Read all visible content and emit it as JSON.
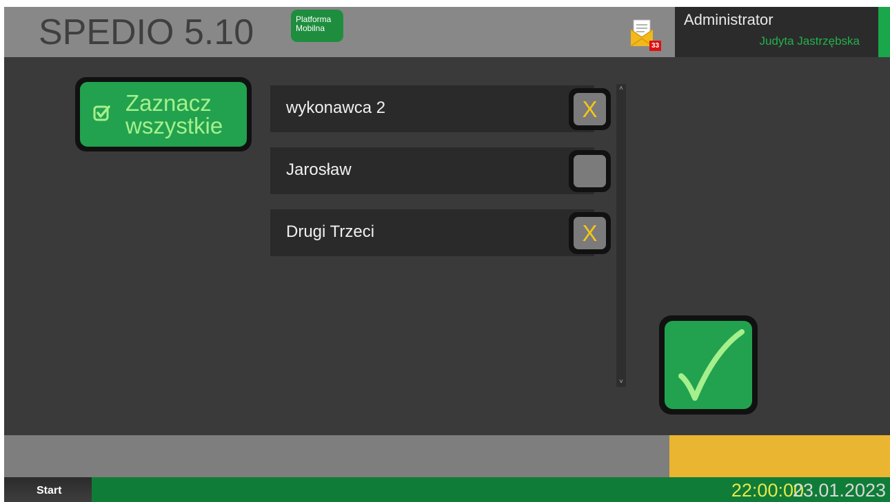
{
  "header": {
    "app_title": "SPEDIO 5.10",
    "platform_badge": [
      "Platforma",
      "Mobilna"
    ],
    "mail_icon": "envelope-document-icon",
    "mail_count": "33",
    "user_role": "Administrator",
    "user_name": "Judyta Jastrzębska"
  },
  "select_all": {
    "icon": "checkbox-checked-icon",
    "label": "Zaznacz wszystkie"
  },
  "list": {
    "items": [
      {
        "label": "wykonawca 2",
        "checked": true,
        "mark": "X"
      },
      {
        "label": "Jarosław",
        "checked": false,
        "mark": ""
      },
      {
        "label": "Drugi Trzeci",
        "checked": true,
        "mark": "X"
      }
    ]
  },
  "confirm": {
    "icon": "checkmark-icon"
  },
  "taskbar": {
    "start_label": "Start",
    "time": "22:00:00",
    "date": "23.01.2023"
  },
  "colors": {
    "accent_green": "#22a24f",
    "mark_yellow": "#f5c518",
    "status_yellow": "#eab530",
    "taskbar_green": "#0f7d37",
    "badge_red": "#e01010"
  }
}
